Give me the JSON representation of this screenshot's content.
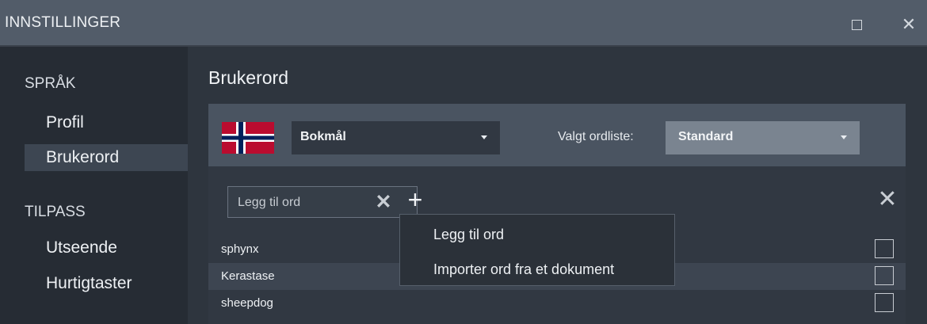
{
  "window": {
    "title": "INNSTILLINGER",
    "close_glyph": "✕"
  },
  "sidebar": {
    "sections": [
      {
        "label": "SPRÅK",
        "items": [
          {
            "label": "Profil"
          },
          {
            "label": "Brukerord",
            "active": true
          }
        ]
      },
      {
        "label": "TILPASS",
        "items": [
          {
            "label": "Utseende"
          },
          {
            "label": "Hurtigtaster"
          }
        ]
      }
    ]
  },
  "main": {
    "title": "Brukerord",
    "flag": {
      "name": "norway-flag-icon",
      "colors": {
        "red": "#ba0c2f",
        "white": "#ffffff",
        "blue": "#00205b"
      }
    },
    "language_select": {
      "value": "Bokmål"
    },
    "wordlist": {
      "label": "Valgt ordliste:",
      "value": "Standard"
    },
    "add_word": {
      "placeholder": "Legg til ord",
      "value": "",
      "clear_glyph": "✕",
      "add_glyph": "+"
    },
    "close_glyph": "✕",
    "words": [
      {
        "text": "sphynx"
      },
      {
        "text": "Kerastase"
      },
      {
        "text": "sheepdog"
      }
    ]
  },
  "context_menu": {
    "items": [
      {
        "label": "Legg til ord"
      },
      {
        "label": "Importer ord fra et dokument"
      }
    ]
  },
  "colors": {
    "titlebar": "#525c69",
    "sidebar": "#262c34",
    "main": "#2e353e",
    "panel_header": "#4a5461",
    "wordlist_select": "#7a8490",
    "alt_row": "#3d4551"
  }
}
